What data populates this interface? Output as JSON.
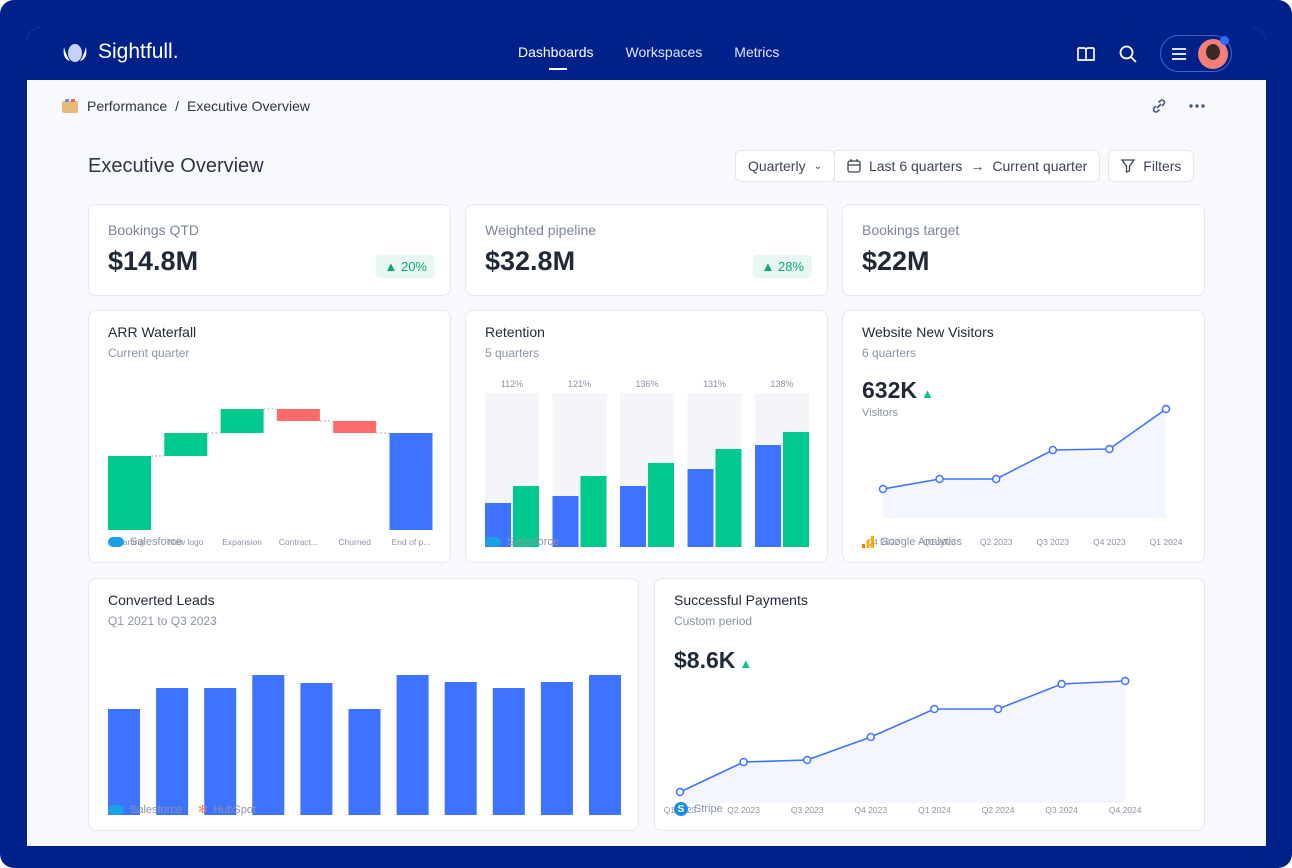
{
  "app": {
    "brand": "Sightfull.",
    "nav": [
      "Dashboards",
      "Workspaces",
      "Metrics"
    ],
    "active_nav": "Dashboards"
  },
  "breadcrumb": {
    "parent": "Performance",
    "separator": "/",
    "current": "Executive Overview"
  },
  "page": {
    "title": "Executive Overview",
    "period_select": "Quarterly",
    "range_from": "Last 6 quarters",
    "range_to": "Current quarter",
    "filters_label": "Filters"
  },
  "kpis": [
    {
      "label": "Bookings QTD",
      "value": "$14.8M",
      "change": "20%"
    },
    {
      "label": "Weighted pipeline",
      "value": "$32.8M",
      "change": "28%"
    },
    {
      "label": "Bookings target",
      "value": "$22M"
    }
  ],
  "colors": {
    "nav": "#00218a",
    "green": "#00c98d",
    "red": "#ff6b6b",
    "blue": "#3d73ff"
  },
  "arr": {
    "title": "ARR Waterfall",
    "subtitle": "Current quarter",
    "source": "Salesforce"
  },
  "retention": {
    "title": "Retention",
    "subtitle": "5 quarters",
    "source": "Salesforce"
  },
  "visitors": {
    "title": "Website New Visitors",
    "subtitle": "6 quarters",
    "value": "632K",
    "value_label": "Visitors",
    "source": "Google Analytics"
  },
  "leads": {
    "title": "Converted Leads",
    "subtitle": "Q1 2021 to Q3 2023",
    "sources": [
      "Salesforce",
      "HubSpot"
    ]
  },
  "payments": {
    "title": "Successful Payments",
    "subtitle": "Custom period",
    "value": "$8.6K",
    "source": "Stripe"
  },
  "chart_data": [
    {
      "type": "bar",
      "name": "arr-waterfall",
      "categories": [
        "Starting",
        "New logo",
        "Expansion",
        "Contract...",
        "Churned",
        "End of p..."
      ],
      "values": [
        74,
        23,
        24,
        -12,
        -12,
        97
      ],
      "kinds": [
        "total",
        "increase",
        "increase",
        "decrease",
        "decrease",
        "total"
      ]
    },
    {
      "type": "bar",
      "name": "retention",
      "categories": [
        "112%",
        "121%",
        "136%",
        "131%",
        "138%"
      ],
      "series": [
        {
          "values": [
            44,
            51,
            61,
            78,
            102
          ]
        },
        {
          "values": [
            61,
            71,
            84,
            98,
            115
          ]
        }
      ]
    },
    {
      "type": "line",
      "name": "visitors",
      "categories": [
        "Q4 2022",
        "Q1 2023",
        "Q2 2023",
        "Q3 2023",
        "Q4 2023",
        "Q1 2024"
      ],
      "values": [
        29,
        39,
        39,
        68,
        69,
        109
      ]
    },
    {
      "type": "bar",
      "name": "leads",
      "values": [
        106,
        127,
        127,
        140,
        132,
        106,
        140,
        133,
        127,
        133,
        140
      ]
    },
    {
      "type": "line",
      "name": "payments",
      "categories": [
        "Q1 2023",
        "Q2 2023",
        "Q3 2023",
        "Q4 2023",
        "Q1 2024",
        "Q2 2024",
        "Q3 2024",
        "Q4 2024"
      ],
      "values": [
        11,
        41,
        43,
        66,
        94,
        94,
        119,
        122
      ]
    }
  ]
}
